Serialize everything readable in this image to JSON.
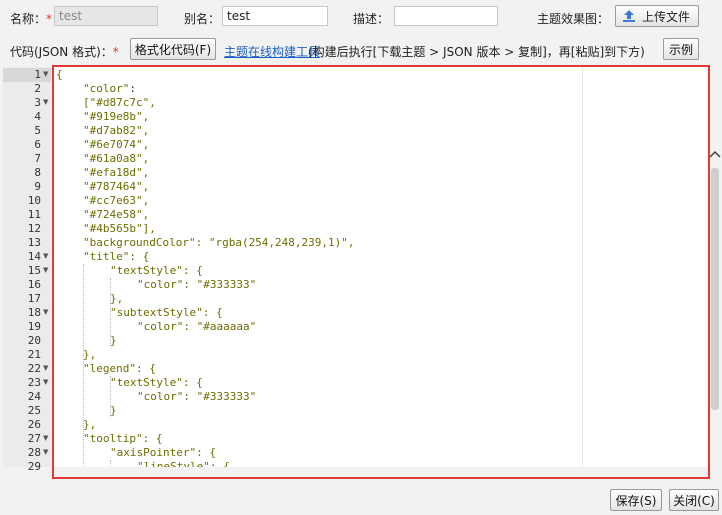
{
  "form": {
    "name_label": "名称：",
    "required_mark": "*",
    "name_value": "test",
    "alias_label": "别名：",
    "alias_value": "test",
    "desc_label": "描述：",
    "desc_value": "",
    "preview_label": "主题效果图：",
    "upload_label": "上传文件"
  },
  "toolbar": {
    "code_label": "代码(JSON 格式)：",
    "format_button": "格式化代码(F)",
    "tool_link": "主题在线构建工具",
    "hint": "(构建后执行[下载主题 > JSON 版本 > 复制]，再[粘贴]到下方)",
    "example_button": "示例"
  },
  "editor": {
    "lines": [
      {
        "n": "1",
        "fold": true,
        "indent": 0,
        "text": "{"
      },
      {
        "n": "2",
        "fold": false,
        "indent": 1,
        "key": "\"color\"",
        "rest": ":"
      },
      {
        "n": "3",
        "fold": true,
        "indent": 1,
        "text": "[\"#d87c7c\","
      },
      {
        "n": "4",
        "fold": false,
        "indent": 1,
        "text": "\"#919e8b\","
      },
      {
        "n": "5",
        "fold": false,
        "indent": 1,
        "text": "\"#d7ab82\","
      },
      {
        "n": "6",
        "fold": false,
        "indent": 1,
        "text": "\"#6e7074\","
      },
      {
        "n": "7",
        "fold": false,
        "indent": 1,
        "text": "\"#61a0a8\","
      },
      {
        "n": "8",
        "fold": false,
        "indent": 1,
        "text": "\"#efa18d\","
      },
      {
        "n": "9",
        "fold": false,
        "indent": 1,
        "text": "\"#787464\","
      },
      {
        "n": "10",
        "fold": false,
        "indent": 1,
        "text": "\"#cc7e63\","
      },
      {
        "n": "11",
        "fold": false,
        "indent": 1,
        "text": "\"#724e58\","
      },
      {
        "n": "12",
        "fold": false,
        "indent": 1,
        "text": "\"#4b565b\"],"
      },
      {
        "n": "13",
        "fold": false,
        "indent": 1,
        "text": "\"backgroundColor\": \"rgba(254,248,239,1)\","
      },
      {
        "n": "14",
        "fold": true,
        "indent": 1,
        "text": "\"title\": {"
      },
      {
        "n": "15",
        "fold": true,
        "indent": 2,
        "text": "\"textStyle\": {"
      },
      {
        "n": "16",
        "fold": false,
        "indent": 3,
        "text": "\"color\": \"#333333\""
      },
      {
        "n": "17",
        "fold": false,
        "indent": 2,
        "text": "},"
      },
      {
        "n": "18",
        "fold": true,
        "indent": 2,
        "text": "\"subtextStyle\": {"
      },
      {
        "n": "19",
        "fold": false,
        "indent": 3,
        "text": "\"color\": \"#aaaaaa\""
      },
      {
        "n": "20",
        "fold": false,
        "indent": 2,
        "text": "}"
      },
      {
        "n": "21",
        "fold": false,
        "indent": 1,
        "text": "},"
      },
      {
        "n": "22",
        "fold": true,
        "indent": 1,
        "text": "\"legend\": {"
      },
      {
        "n": "23",
        "fold": true,
        "indent": 2,
        "text": "\"textStyle\": {"
      },
      {
        "n": "24",
        "fold": false,
        "indent": 3,
        "text": "\"color\": \"#333333\""
      },
      {
        "n": "25",
        "fold": false,
        "indent": 2,
        "text": "}"
      },
      {
        "n": "26",
        "fold": false,
        "indent": 1,
        "text": "},"
      },
      {
        "n": "27",
        "fold": true,
        "indent": 1,
        "text": "\"tooltip\": {"
      },
      {
        "n": "28",
        "fold": true,
        "indent": 2,
        "text": "\"axisPointer\": {"
      },
      {
        "n": "29",
        "fold": false,
        "indent": 3,
        "text": "\"lineStyle\": {"
      }
    ]
  },
  "footer": {
    "save_button": "保存(S)",
    "close_button": "关闭(C)"
  },
  "colors": {
    "highlight_border": "#e53935",
    "link": "#1a5fc4",
    "json_text": "#6d6d00"
  }
}
